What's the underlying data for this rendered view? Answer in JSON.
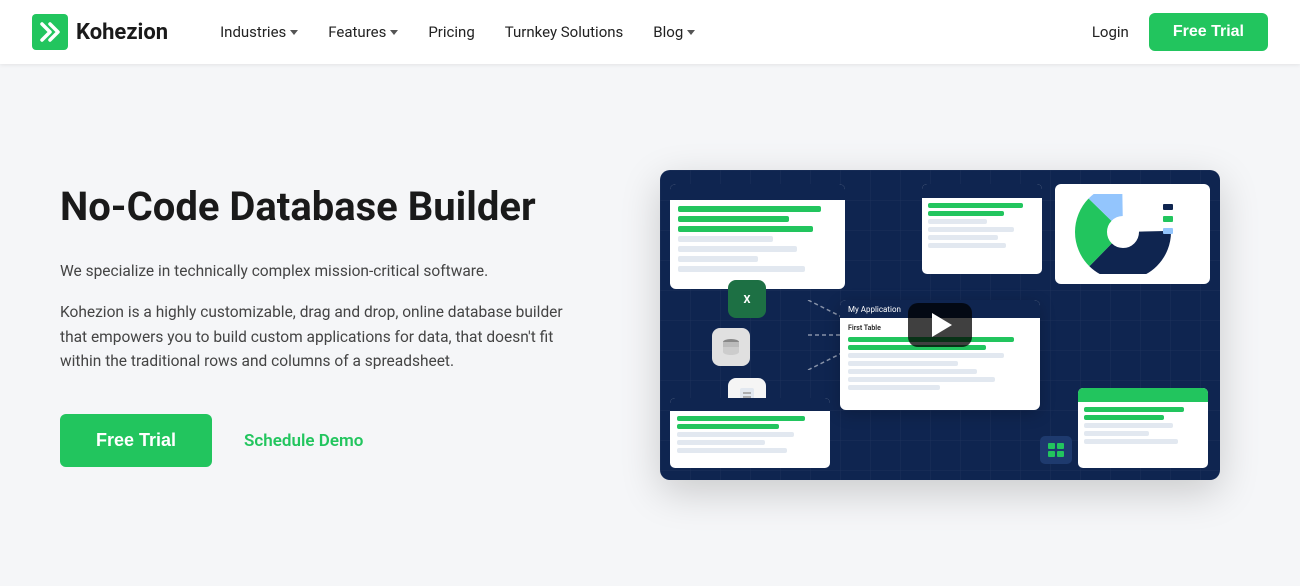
{
  "brand": {
    "name": "Kohezion",
    "logo_alt": "Kohezion logo"
  },
  "nav": {
    "items": [
      {
        "label": "Industries",
        "has_dropdown": true
      },
      {
        "label": "Features",
        "has_dropdown": true
      },
      {
        "label": "Pricing",
        "has_dropdown": false
      },
      {
        "label": "Turnkey Solutions",
        "has_dropdown": false
      },
      {
        "label": "Blog",
        "has_dropdown": true
      }
    ],
    "login_label": "Login",
    "free_trial_label": "Free Trial"
  },
  "hero": {
    "title": "No-Code Database Builder",
    "desc1": "We specialize in technically complex mission-critical software.",
    "desc2": "Kohezion is a highly customizable, drag and drop, online database builder that empowers you to build custom applications for data, that doesn't fit within the traditional rows and columns of a spreadsheet.",
    "cta_primary": "Free Trial",
    "cta_secondary": "Schedule Demo"
  },
  "colors": {
    "green": "#22c55e",
    "navy": "#0f2550",
    "text_dark": "#1a1a1a",
    "text_mid": "#444"
  }
}
